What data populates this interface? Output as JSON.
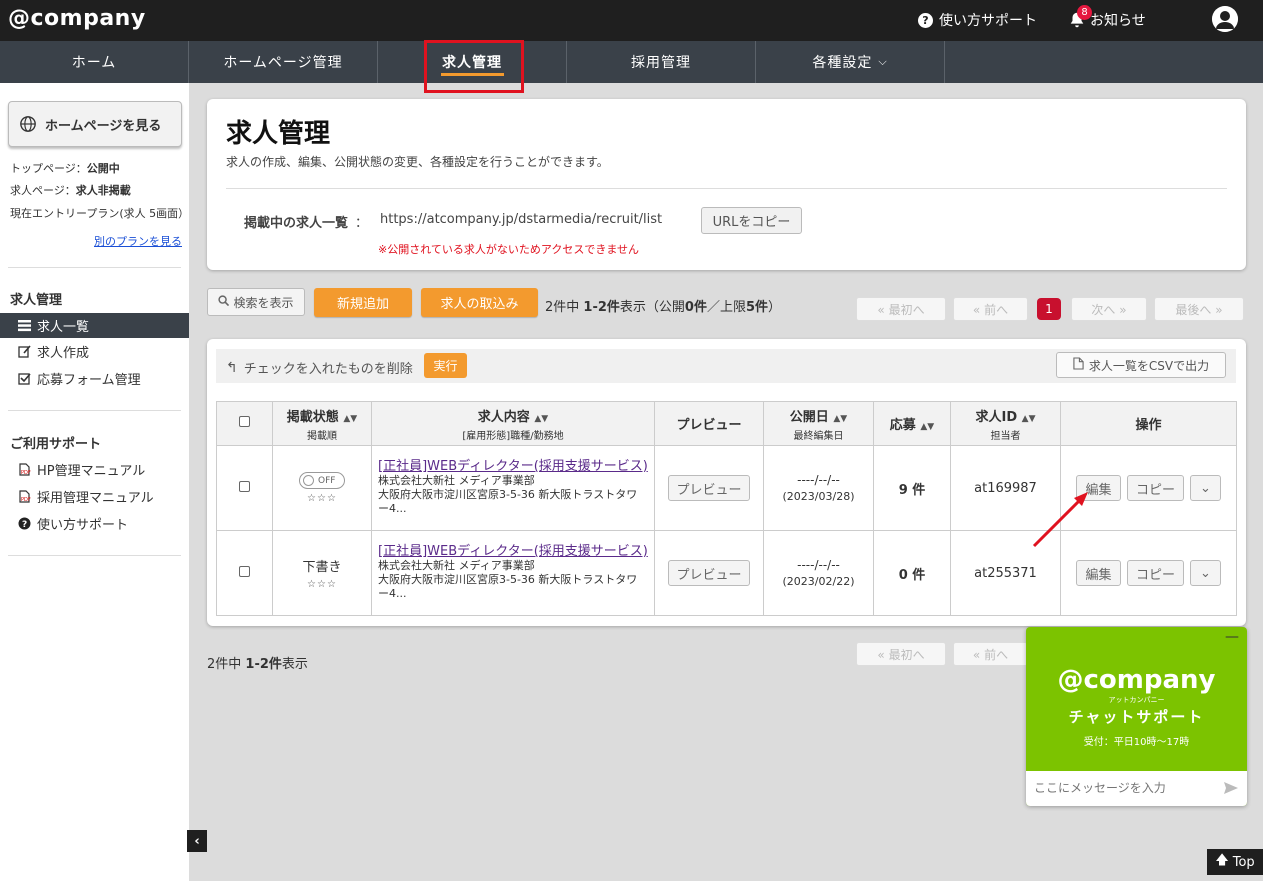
{
  "header": {
    "logo": "@company",
    "help_label": "使い方サポート",
    "notice_label": "お知らせ",
    "notice_count": "8"
  },
  "nav": {
    "items": [
      "ホーム",
      "ホームページ管理",
      "求人管理",
      "採用管理",
      "各種設定"
    ],
    "active": "求人管理"
  },
  "sidebar": {
    "hp_button": "ホームページを見る",
    "top_page_label": "トップページ：",
    "top_page_value": "公開中",
    "job_page_label": "求人ページ：",
    "job_page_value": "求人非掲載",
    "plan_text": "現在エントリープラン(求人 5画面）",
    "other_plan_link": "別のプランを見る",
    "section1_title": "求人管理",
    "section1_items": [
      "求人一覧",
      "求人作成",
      "応募フォーム管理"
    ],
    "section2_title": "ご利用サポート",
    "section2_items": [
      "HP管理マニュアル",
      "採用管理マニュアル",
      "使い方サポート"
    ]
  },
  "title_card": {
    "title": "求人管理",
    "description": "求人の作成、編集、公開状態の変更、各種設定を行うことができます。",
    "list_label": "掲載中の求人一覧",
    "list_sep": "：",
    "list_url": "https://atcompany.jp/dstarmedia/recruit/list",
    "copy_url_button": "URLをコピー",
    "warning": "※公開されている求人がないためアクセスできません"
  },
  "toolbar": {
    "search_button": "検索を表示",
    "add_button": "新規追加",
    "import_button": "求人の取込み",
    "count_prefix": "2件中 ",
    "count_range": "1-2件",
    "count_suffix_a": "表示（公開",
    "count_public": "0件",
    "count_suffix_b": "／上限",
    "count_limit": "5件",
    "count_suffix_c": "）"
  },
  "pager": {
    "first": "« 最初へ",
    "prev": "« 前へ",
    "current": "1",
    "next": "次へ »",
    "last": "最後へ »"
  },
  "list": {
    "delete_label": "チェックを入れたものを削除",
    "exec_button": "実行",
    "csv_button": "求人一覧をCSVで出力",
    "columns": {
      "status": "掲載状態",
      "status_sub": "掲載順",
      "content": "求人内容",
      "content_sub": "[雇用形態]職種/勤務地",
      "preview": "プレビュー",
      "date": "公開日",
      "date_sub": "最終編集日",
      "apply": "応募",
      "id": "求人ID",
      "id_sub": "担当者",
      "ops": "操作"
    },
    "rows": [
      {
        "status": "OFF",
        "stars": "☆☆☆",
        "title": "[正社員]WEBディレクター(採用支援サービス)",
        "company": "株式会社大新社 メディア事業部",
        "address": "大阪府大阪市淀川区宮原3-5-36 新大阪トラストタワー4...",
        "preview": "プレビュー",
        "pub_date": "----/--/--",
        "edit_date": "(2023/03/28)",
        "apply": "9 件",
        "job_id": "at169987",
        "edit": "編集",
        "copy": "コピー"
      },
      {
        "status": "下書き",
        "stars": "☆☆☆",
        "title": "[正社員]WEBディレクター(採用支援サービス)",
        "company": "株式会社大新社 メディア事業部",
        "address": "大阪府大阪市淀川区宮原3-5-36 新大阪トラストタワー4...",
        "preview": "プレビュー",
        "pub_date": "----/--/--",
        "edit_date": "(2023/02/22)",
        "apply": "0 件",
        "job_id": "at255371",
        "edit": "編集",
        "copy": "コピー"
      }
    ]
  },
  "bottom": {
    "count_prefix": "2件中 ",
    "count_range": "1-2件",
    "count_suffix": "表示",
    "first": "« 最初へ",
    "prev": "« 前へ"
  },
  "chat": {
    "logo": "@company",
    "kana": "アットカンパニー",
    "title": "チャットサポート",
    "hours": "受付：平日10時～17時",
    "placeholder": "ここにメッセージを入力",
    "minimize": "—"
  },
  "top_button": "Top",
  "colors": {
    "accent_orange": "#f39a2e",
    "highlight_red": "#e0121f",
    "chat_green": "#7cc300",
    "nav_bg": "#3a4149"
  }
}
